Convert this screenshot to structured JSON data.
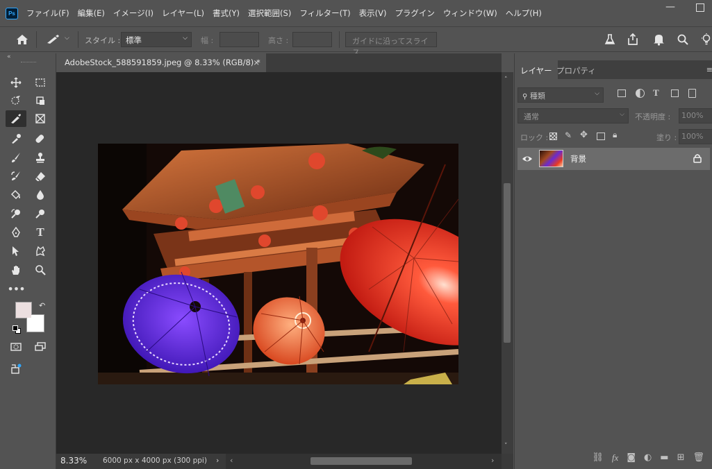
{
  "app": {
    "logo": "Ps"
  },
  "menu": [
    "ファイル(F)",
    "編集(E)",
    "イメージ(I)",
    "レイヤー(L)",
    "書式(Y)",
    "選択範囲(S)",
    "フィルター(T)",
    "表示(V)",
    "プラグイン",
    "ウィンドウ(W)",
    "ヘルプ(H)"
  ],
  "window": {
    "minimize_icon": "minimize-icon",
    "maximize_icon": "maximize-icon"
  },
  "options_bar": {
    "style_label": "スタイル :",
    "style_value": "標準",
    "width_label": "幅 :",
    "height_label": "高さ :",
    "slice_button": "ガイドに沿ってスライス"
  },
  "document": {
    "tab_title": "AdobeStock_588591859.jpeg @ 8.33% (RGB/8) *",
    "close_glyph": "×"
  },
  "status": {
    "zoom": "8.33%",
    "doc_info": "6000 px x 4000 px (300 ppi)"
  },
  "panel": {
    "tabs": [
      "レイヤー",
      "プロパティ"
    ],
    "filter_value": "種類",
    "blend_mode": "通常",
    "opacity_label": "不透明度 :",
    "opacity_value": "100%",
    "lock_label": "ロック :",
    "fill_label": "塗り :",
    "fill_value": "100%",
    "layer_name": "背景"
  },
  "colors": {
    "foreground": "#ecdfe0",
    "background": "#ffffff",
    "accent": "#31a8ff"
  }
}
